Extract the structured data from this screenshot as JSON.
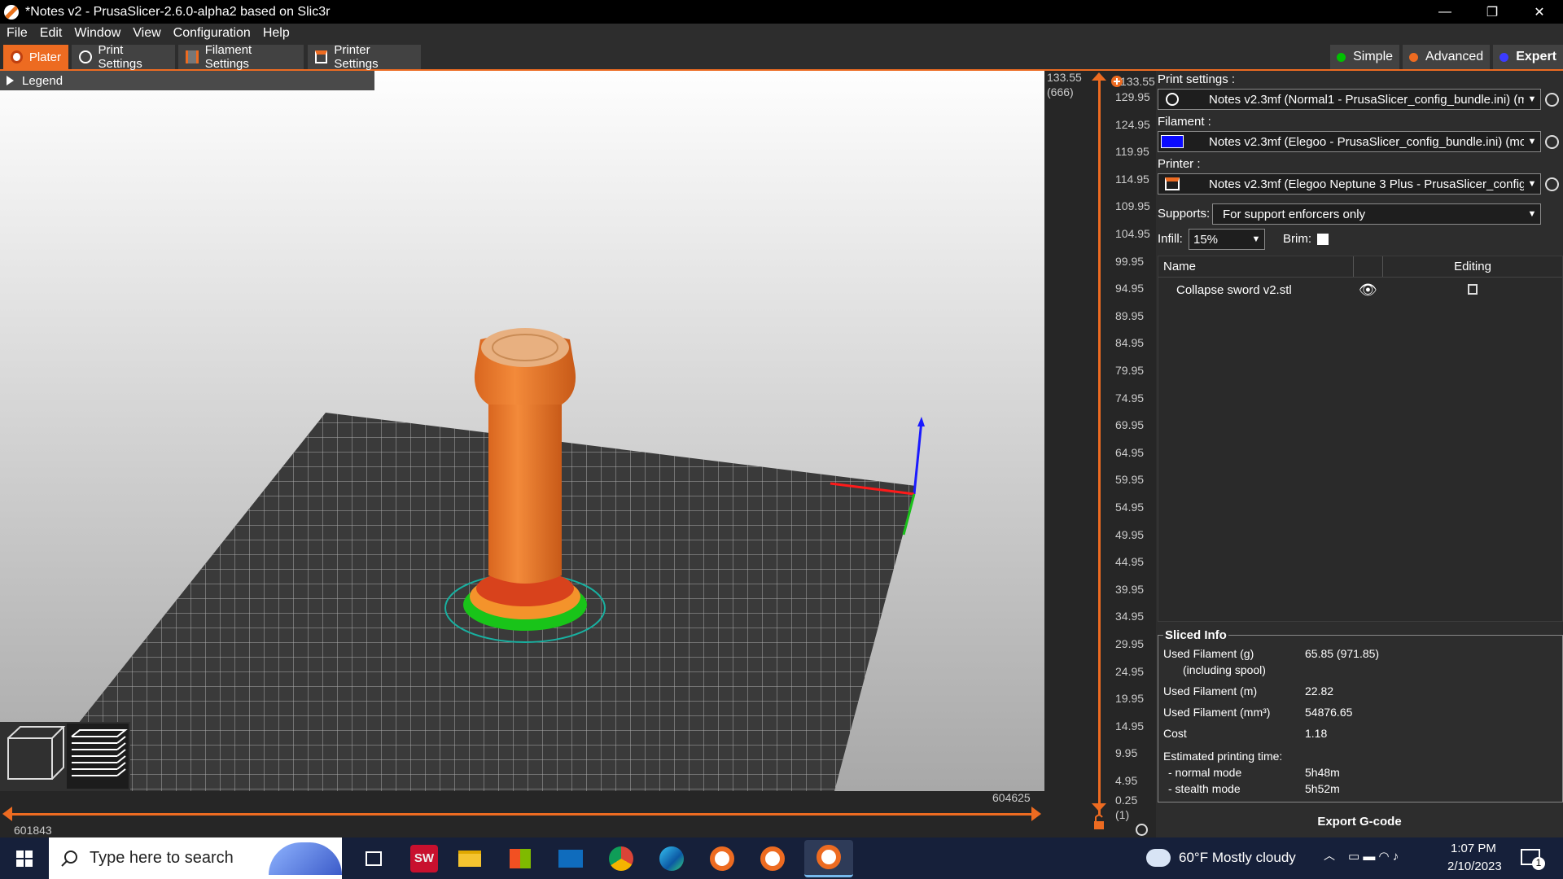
{
  "window": {
    "title": "*Notes v2 - PrusaSlicer-2.6.0-alpha2 based on Slic3r",
    "controls": [
      "—",
      "❐",
      "✕"
    ]
  },
  "menu": [
    "File",
    "Edit",
    "Window",
    "View",
    "Configuration",
    "Help"
  ],
  "tabs": [
    {
      "label": "Plater",
      "icon": "plater-icon"
    },
    {
      "label": "Print Settings",
      "icon": "gear-icon"
    },
    {
      "label": "Filament Settings",
      "icon": "spool-icon"
    },
    {
      "label": "Printer Settings",
      "icon": "printer-icon"
    }
  ],
  "modes": [
    {
      "label": "Simple",
      "color": "#00c000"
    },
    {
      "label": "Advanced",
      "color": "#ed6b21"
    },
    {
      "label": "Expert",
      "color": "#3b3bff"
    }
  ],
  "legend": {
    "label": "Legend"
  },
  "vertical_slider": {
    "top_value": "133.55",
    "top_layer": "(666)",
    "current_value": "133.55",
    "bottom_value": "0.25",
    "bottom_layer": "(1)",
    "ticks": [
      "129.95",
      "124.95",
      "119.95",
      "114.95",
      "109.95",
      "104.95",
      "99.95",
      "94.95",
      "89.95",
      "84.95",
      "79.95",
      "74.95",
      "69.95",
      "64.95",
      "59.95",
      "54.95",
      "49.95",
      "44.95",
      "39.95",
      "34.95",
      "29.95",
      "24.95",
      "19.95",
      "14.95",
      "9.95",
      "4.95"
    ]
  },
  "horizontal_slider": {
    "left_value": "601843",
    "right_value": "604625"
  },
  "print_settings": {
    "label": "Print settings :",
    "value": "Notes v2.3mf (Normal1 - PrusaSlicer_config_bundle.ini) (m"
  },
  "filament": {
    "label": "Filament :",
    "value": "Notes v2.3mf (Elegoo - PrusaSlicer_config_bundle.ini) (mo",
    "color": "#0a0aff"
  },
  "printer": {
    "label": "Printer :",
    "value": "Notes v2.3mf (Elegoo Neptune 3 Plus - PrusaSlicer_config_"
  },
  "supports": {
    "label": "Supports:",
    "value": "For support enforcers only"
  },
  "infill": {
    "label": "Infill:",
    "value": "15%"
  },
  "brim": {
    "label": "Brim:",
    "checked": false
  },
  "object_list": {
    "headers": [
      "Name",
      "Editing"
    ],
    "items": [
      {
        "name": "Collapse sword v2.stl"
      }
    ]
  },
  "sliced_info": {
    "title": "Sliced Info",
    "rows": [
      {
        "label": "Used Filament (g)",
        "sub": "(including spool)",
        "value": "65.85 (971.85)"
      },
      {
        "label": "Used Filament (m)",
        "value": "22.82"
      },
      {
        "label": "Used Filament (mm³)",
        "value": "54876.65"
      },
      {
        "label": "Cost",
        "value": "1.18"
      }
    ],
    "time_label": "Estimated printing time:",
    "normal_label": "- normal mode",
    "normal_value": "5h48m",
    "stealth_label": "- stealth mode",
    "stealth_value": "5h52m"
  },
  "export_button": "Export G-code",
  "taskbar": {
    "search_placeholder": "Type here to search",
    "weather": "60°F  Mostly cloudy",
    "time": "1:07 PM",
    "date": "2/10/2023",
    "notifications": "1",
    "apps": [
      "task-view-icon",
      "solidworks-icon",
      "file-explorer-icon",
      "store-icon",
      "mail-icon",
      "chrome-icon",
      "edge-icon",
      "prusaslicer-icon",
      "prusaslicer-icon",
      "prusaslicer-icon"
    ]
  }
}
